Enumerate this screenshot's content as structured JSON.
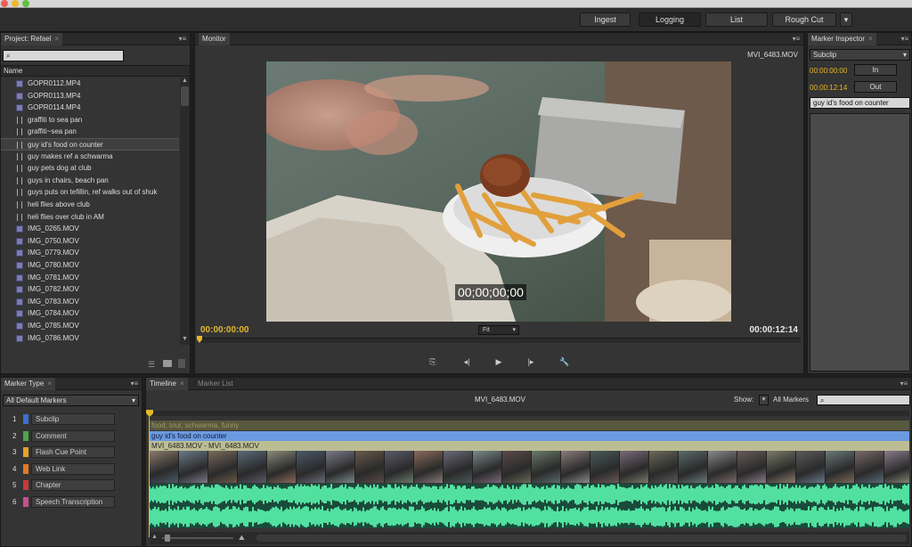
{
  "workspace": {
    "buttons": [
      "Ingest",
      "Logging",
      "List",
      "Rough Cut"
    ],
    "active": "Logging",
    "menu_icon": "chevron-down-icon"
  },
  "project": {
    "tab": "Project: Refael",
    "search_icon": "search-icon",
    "column_header": "Name",
    "items": [
      {
        "name": "GOPR0112.MP4",
        "kind": "clip"
      },
      {
        "name": "GOPR0113.MP4",
        "kind": "clip"
      },
      {
        "name": "GOPR0114.MP4",
        "kind": "clip"
      },
      {
        "name": "graffiti to sea pan",
        "kind": "subclip"
      },
      {
        "name": "graffiti~sea pan",
        "kind": "subclip"
      },
      {
        "name": "guy id's food on counter",
        "kind": "subclip",
        "selected": true
      },
      {
        "name": "guy makes ref a schwarma",
        "kind": "subclip"
      },
      {
        "name": "guy pets dog at club",
        "kind": "subclip"
      },
      {
        "name": "guys in chairs, beach pan",
        "kind": "subclip"
      },
      {
        "name": "guys puts on tefillin, ref walks out of shuk",
        "kind": "subclip"
      },
      {
        "name": "heli flies above club",
        "kind": "subclip"
      },
      {
        "name": "heli flies over club in AM",
        "kind": "subclip"
      },
      {
        "name": "IMG_0265.MOV",
        "kind": "clip"
      },
      {
        "name": "IMG_0750.MOV",
        "kind": "clip"
      },
      {
        "name": "IMG_0779.MOV",
        "kind": "clip"
      },
      {
        "name": "IMG_0780.MOV",
        "kind": "clip"
      },
      {
        "name": "IMG_0781.MOV",
        "kind": "clip"
      },
      {
        "name": "IMG_0782.MOV",
        "kind": "clip"
      },
      {
        "name": "IMG_0783.MOV",
        "kind": "clip"
      },
      {
        "name": "IMG_0784.MOV",
        "kind": "clip"
      },
      {
        "name": "IMG_0785.MOV",
        "kind": "clip"
      },
      {
        "name": "IMG_0786.MOV",
        "kind": "clip"
      }
    ]
  },
  "monitor": {
    "tab": "Monitor",
    "clip": "MVI_6483.MOV",
    "tc_in": "00:00:00:00",
    "tc_out": "00:00:12:14",
    "overlay_tc": "00;00;00;00",
    "zoom": "Fit"
  },
  "inspector": {
    "tab": "Marker Inspector",
    "type": "Subclip",
    "in_tc": "00:00:00:00",
    "out_tc": "00:00:12:14",
    "in_label": "In",
    "out_label": "Out",
    "name": "guy id's food on counter"
  },
  "marker_type": {
    "tab": "Marker Type",
    "filter": "All Default Markers",
    "types": [
      {
        "n": "1",
        "label": "Subclip",
        "color": "#3d6fcc"
      },
      {
        "n": "2",
        "label": "Comment",
        "color": "#4aa54a"
      },
      {
        "n": "3",
        "label": "Flash Cue Point",
        "color": "#e3a32c"
      },
      {
        "n": "4",
        "label": "Web Link",
        "color": "#e07a2c"
      },
      {
        "n": "5",
        "label": "Chapter",
        "color": "#c83a3a"
      },
      {
        "n": "6",
        "label": "Speech Transcription",
        "color": "#c4508e"
      }
    ]
  },
  "timeline": {
    "tabs": [
      "Timeline",
      "Marker List"
    ],
    "clip": "MVI_6483.MOV",
    "show_label": "Show:",
    "show_value": "All Markers",
    "comment": "food, tour, schwarma, funny",
    "subclip": "guy id's food on counter",
    "track": "MVI_6483.MOV - MVI_6483.MOV"
  },
  "colors": {
    "accent_tc": "#e3b72c",
    "subclip_bar": "#6c9ae0",
    "audio": "#52e0a0"
  }
}
